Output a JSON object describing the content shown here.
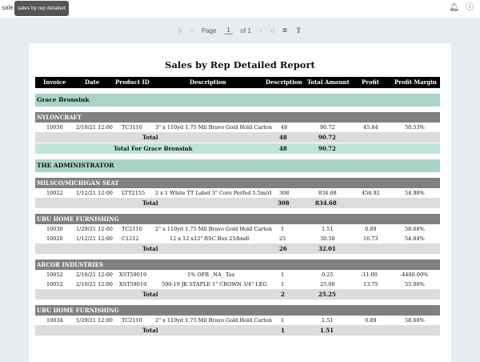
{
  "app": {
    "name": "sale",
    "tooltip": "sales by rep detailed"
  },
  "topbar": {
    "bell_icon": "bell-icon",
    "info_icon": "info-icon"
  },
  "pager": {
    "page_label": "Page",
    "current_page": "1",
    "of_label": "of 1"
  },
  "report": {
    "title": "Sales by Rep Detailed Report",
    "columns": [
      "Invoice",
      "Date",
      "Product ID",
      "Description",
      "Description",
      "Total Amount",
      "Profit",
      "Profit Margin"
    ],
    "rep1": {
      "name": "Grace Bronsink",
      "cust1": {
        "name": "NYLONCRAFT",
        "rows": [
          {
            "invoice": "10050",
            "date": "2/10/21 12:00",
            "product": "TC3110",
            "desc": "3\" x 110yd 1.75 Mil Bravo Gold Hold Carton",
            "qty": "48",
            "amount": "90.72",
            "profit": "45.84",
            "margin": "50.53%"
          }
        ],
        "total_label": "Total",
        "total_qty": "48",
        "total_amount": "90.72"
      },
      "total_label": "Total For Grace Bronsink",
      "total_qty": "48",
      "total_amount": "90.72"
    },
    "rep2": {
      "name": "THE ADMINISTRATOR",
      "cust1": {
        "name": "MILSCO/MICHIGAN SEAT",
        "rows": [
          {
            "invoice": "10022",
            "date": "1/12/21 12:00",
            "product": "LTT2155",
            "desc": "2 x 1 White TT Label 3\" Core Perfed 5.5m/rl",
            "qty": "308",
            "amount": "834.68",
            "profit": "458.92",
            "margin": "54.98%"
          }
        ],
        "total_label": "Total",
        "total_qty": "308",
        "total_amount": "834.68"
      },
      "cust2": {
        "name": "UBU HOME FURNISHING",
        "rows": [
          {
            "invoice": "10030",
            "date": "1/29/21 12:00",
            "product": "TC2110",
            "desc": "2\" x 110yd 1.75 Mil Bravo Gold Hold Carton",
            "qty": "1",
            "amount": "1.51",
            "profit": "0.89",
            "margin": "58.68%"
          },
          {
            "invoice": "10020",
            "date": "1/12/21 12:00",
            "product": "C1212",
            "desc": "12 x 12 x12\" RSC Box 25/bndl",
            "qty": "25",
            "amount": "30.50",
            "profit": "16.73",
            "margin": "54.84%"
          }
        ],
        "total_label": "Total",
        "total_qty": "26",
        "total_amount": "32.01"
      },
      "cust3": {
        "name": "ABCOR INDUSTRIES",
        "rows": [
          {
            "invoice": "10052",
            "date": "2/10/21 12:00",
            "product": "XST59019",
            "desc": "1% OFB _NA_ Tax",
            "qty": "1",
            "amount": "0.25",
            "profit": "-11.00",
            "margin": "-4400.00%"
          },
          {
            "invoice": "10052",
            "date": "2/10/21 12:00",
            "product": "XST59019",
            "desc": "590-19 JK STAPLE 1\" CROWN 3/4\" LEG",
            "qty": "1",
            "amount": "25.00",
            "profit": "13.75",
            "margin": "55.00%"
          }
        ],
        "total_label": "Total",
        "total_qty": "2",
        "total_amount": "25.25"
      },
      "cust4": {
        "name": "UBU HOME FURNISHING",
        "rows": [
          {
            "invoice": "10034",
            "date": "1/29/21 12:00",
            "product": "TC2110",
            "desc": "2\" x 110yd 1.75 Mil Bravo Gold Hold Carton",
            "qty": "1",
            "amount": "1.51",
            "profit": "0.89",
            "margin": "58.68%"
          }
        ],
        "total_label": "Total",
        "total_qty": "1",
        "total_amount": "1.51"
      }
    }
  }
}
